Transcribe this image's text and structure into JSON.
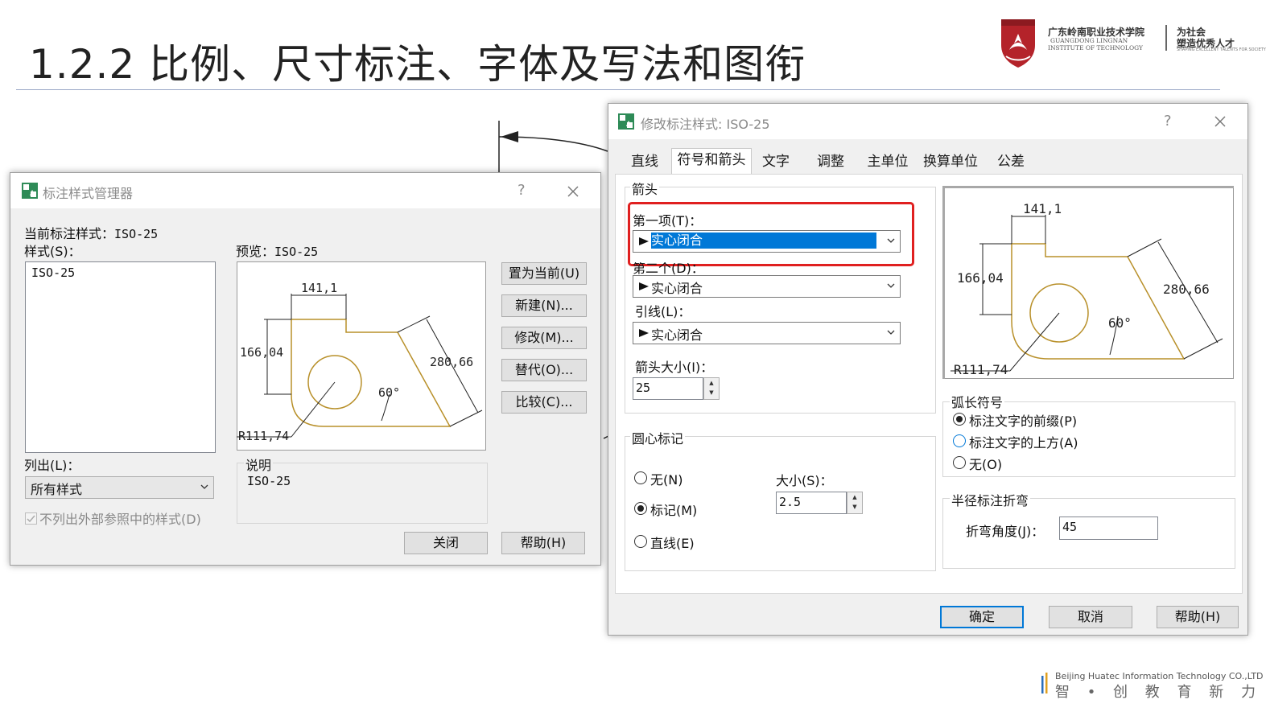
{
  "slide": {
    "title": "1.2.2 比例、尺寸标注、字体及写法和图衔"
  },
  "logo": {
    "cn_name": "广东岭南职业技术学院",
    "en_name_1": "GUANGDONG LINGNAN",
    "en_name_2": "INSTITUTE OF TECHNOLOGY",
    "motto_1": "为社会",
    "motto_2": "塑造优秀人才",
    "motto_small": "SHAPING EXCELLENT TALENTS FOR SOCIETY",
    "brand_color": "#b4232a"
  },
  "footer": {
    "company": "Beijing Huatec Information Technology CO.,LTD",
    "slogan": "智 • 创 教 育 新 力 量",
    "bar_colors": [
      "#2a6ebb",
      "#e0a020"
    ]
  },
  "manager_dialog": {
    "title": "标注样式管理器",
    "help_icon": "?",
    "current_style_label": "当前标注样式：",
    "current_style_value": "ISO-25",
    "styles_label": "样式(S)：",
    "styles_list": [
      "ISO-25"
    ],
    "preview_label": "预览：",
    "preview_value": "ISO-25",
    "list_label": "列出(L)：",
    "list_value": "所有样式",
    "checkbox_label": "不列出外部参照中的样式(D)",
    "description_label": "说明",
    "description_value": "ISO-25",
    "buttons": {
      "set_current": "置为当前(U)",
      "new": "新建(N)...",
      "modify": "修改(M)...",
      "override": "替代(O)...",
      "compare": "比较(C)...",
      "close": "关闭",
      "help": "帮助(H)"
    }
  },
  "preview_drawing": {
    "dim_top": "141,1",
    "dim_left": "166,04",
    "dim_right": "280,66",
    "dim_angle": "60°",
    "dim_radius": "R111,74",
    "line_color": "#b8902a"
  },
  "modify_dialog": {
    "title": "修改标注样式: ISO-25",
    "help_icon": "?",
    "tabs": [
      "直线",
      "符号和箭头",
      "文字",
      "调整",
      "主单位",
      "换算单位",
      "公差"
    ],
    "active_tab": "符号和箭头",
    "arrows_group": "箭头",
    "first_label": "第一项(T)：",
    "first_value": "实心闭合",
    "second_label": "第二个(D)：",
    "second_value": "实心闭合",
    "leader_label": "引线(L)：",
    "leader_value": "实心闭合",
    "arrow_size_label": "箭头大小(I)：",
    "arrow_size_value": "25",
    "center_group": "圆心标记",
    "center_none": "无(N)",
    "center_mark": "标记(M)",
    "center_line": "直线(E)",
    "center_selected": "标记(M)",
    "size_label": "大小(S)：",
    "size_value": "2.5",
    "arc_group": "弧长符号",
    "arc_prefix": "标注文字的前缀(P)",
    "arc_above": "标注文字的上方(A)",
    "arc_none": "无(O)",
    "arc_selected": "标注文字的前缀(P)",
    "jog_group": "半径标注折弯",
    "jog_angle_label": "折弯角度(J)：",
    "jog_angle_value": "45",
    "buttons": {
      "ok": "确定",
      "cancel": "取消",
      "help": "帮助(H)"
    },
    "highlight_color": "#e02020",
    "selection_color": "#0078d7"
  }
}
